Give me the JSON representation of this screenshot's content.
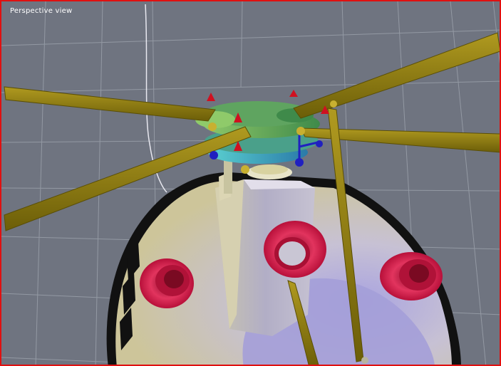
{
  "viewport": {
    "label": "Perspective view",
    "frame_color": "#e01010",
    "background_color": "#6f7480"
  },
  "scene": {
    "objects": [
      "grid-floor",
      "helicopter-body",
      "rotor-hub",
      "rotor-blades",
      "engine-intakes",
      "swashplate-handles"
    ],
    "colors": {
      "blade": "#8a7a10",
      "intake": "#c81e50",
      "hub_green": "#6fb05a",
      "hub_cyan": "#3ab0c0",
      "handle_red": "#d01020",
      "handle_blue": "#2020c0",
      "body_light": "#c9c6b8",
      "body_purple": "#9a92c8"
    }
  }
}
